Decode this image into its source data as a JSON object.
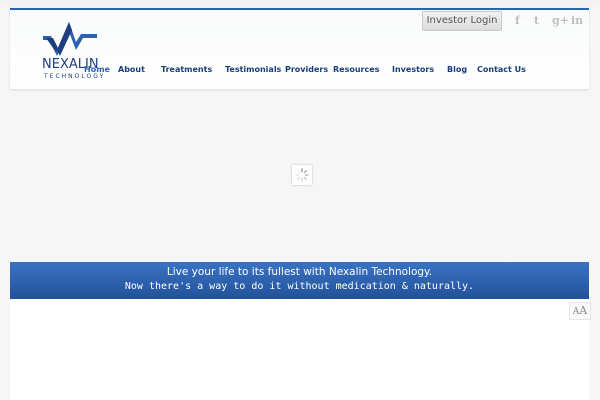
{
  "header": {
    "logo": {
      "name": "NEXALIN",
      "subtitle": "TECHNOLOGY"
    },
    "investor_login_label": "Investor Login",
    "social": [
      {
        "name": "facebook-icon",
        "glyph": "f"
      },
      {
        "name": "twitter-icon",
        "glyph": "t"
      },
      {
        "name": "google-plus-icon",
        "glyph": "g+"
      },
      {
        "name": "linkedin-icon",
        "glyph": "in"
      }
    ],
    "nav": [
      {
        "label": "Home"
      },
      {
        "label": "About"
      },
      {
        "label": "Treatments"
      },
      {
        "label": "Testimonials"
      },
      {
        "label": "Providers"
      },
      {
        "label": "Resources"
      },
      {
        "label": "Investors"
      },
      {
        "label": "Blog"
      },
      {
        "label": "Contact Us"
      }
    ]
  },
  "banner": {
    "line1": "Live your life to its fullest with Nexalin Technology.",
    "line2": "Now there's a way to do it without medication & naturally."
  },
  "font_size_toggle": {
    "small": "A",
    "large": "A"
  },
  "colors": {
    "brand": "#1d3f7d",
    "accent": "#2b62b0",
    "banner": "#2d62b0"
  }
}
